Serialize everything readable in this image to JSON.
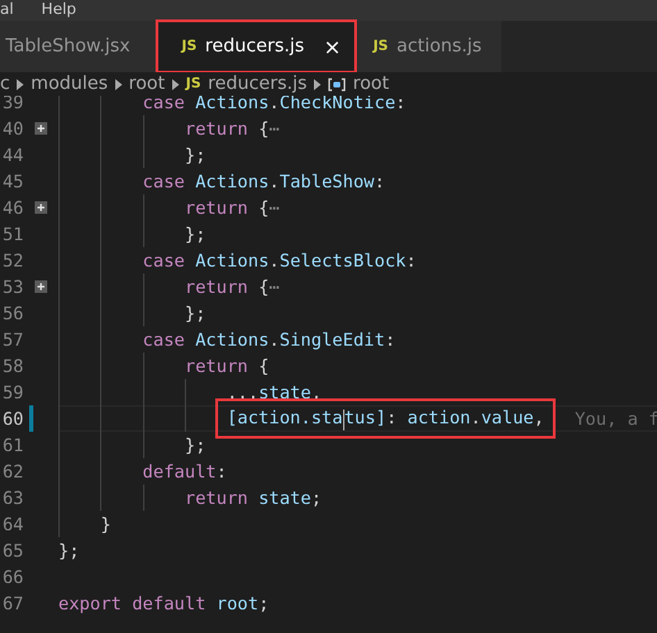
{
  "menu": [
    "al",
    "Help"
  ],
  "tabs": [
    {
      "label": "TableShow.jsx",
      "selected": false,
      "highlighted": false
    },
    {
      "badge": "JS",
      "label": "reducers.js",
      "selected": true,
      "highlighted": true,
      "close": "×"
    },
    {
      "badge": "JS",
      "label": "actions.js",
      "selected": false,
      "highlighted": false
    }
  ],
  "breadcrumb": [
    {
      "kind": "folder",
      "label": "c"
    },
    {
      "kind": "folder",
      "label": "modules"
    },
    {
      "kind": "folder",
      "label": "root"
    },
    {
      "kind": "file",
      "badge": "JS",
      "label": "reducers.js"
    },
    {
      "kind": "symbol",
      "label": "root"
    }
  ],
  "lines": [
    {
      "number": "39",
      "folded": false,
      "current": false,
      "modified": false,
      "highlighted": false,
      "tokens": [
        {
          "kind": "keyword",
          "text": "        case "
        },
        {
          "kind": "variable",
          "text": "Actions"
        },
        {
          "kind": "punct",
          "text": "."
        },
        {
          "kind": "variable",
          "text": "CheckNotice"
        },
        {
          "kind": "punct",
          "text": ":"
        }
      ]
    },
    {
      "number": "40",
      "folded": true,
      "current": false,
      "modified": false,
      "highlighted": false,
      "tokens": [
        {
          "kind": "keyword",
          "text": "            return "
        },
        {
          "kind": "punct",
          "text": "{"
        },
        {
          "kind": "fold",
          "text": "⋯"
        }
      ]
    },
    {
      "number": "44",
      "folded": false,
      "current": false,
      "modified": false,
      "highlighted": false,
      "tokens": [
        {
          "kind": "punct",
          "text": "            };"
        }
      ]
    },
    {
      "number": "45",
      "folded": false,
      "current": false,
      "modified": false,
      "highlighted": false,
      "tokens": [
        {
          "kind": "keyword",
          "text": "        case "
        },
        {
          "kind": "variable",
          "text": "Actions"
        },
        {
          "kind": "punct",
          "text": "."
        },
        {
          "kind": "variable",
          "text": "TableShow"
        },
        {
          "kind": "punct",
          "text": ":"
        }
      ]
    },
    {
      "number": "46",
      "folded": true,
      "current": false,
      "modified": false,
      "highlighted": false,
      "tokens": [
        {
          "kind": "keyword",
          "text": "            return "
        },
        {
          "kind": "punct",
          "text": "{"
        },
        {
          "kind": "fold",
          "text": "⋯"
        }
      ]
    },
    {
      "number": "51",
      "folded": false,
      "current": false,
      "modified": false,
      "highlighted": false,
      "tokens": [
        {
          "kind": "punct",
          "text": "            };"
        }
      ]
    },
    {
      "number": "52",
      "folded": false,
      "current": false,
      "modified": false,
      "highlighted": false,
      "tokens": [
        {
          "kind": "keyword",
          "text": "        case "
        },
        {
          "kind": "variable",
          "text": "Actions"
        },
        {
          "kind": "punct",
          "text": "."
        },
        {
          "kind": "variable",
          "text": "SelectsBlock"
        },
        {
          "kind": "punct",
          "text": ":"
        }
      ]
    },
    {
      "number": "53",
      "folded": true,
      "current": false,
      "modified": false,
      "highlighted": false,
      "tokens": [
        {
          "kind": "keyword",
          "text": "            return "
        },
        {
          "kind": "punct",
          "text": "{"
        },
        {
          "kind": "fold",
          "text": "⋯"
        }
      ]
    },
    {
      "number": "56",
      "folded": false,
      "current": false,
      "modified": false,
      "highlighted": false,
      "tokens": [
        {
          "kind": "punct",
          "text": "            };"
        }
      ]
    },
    {
      "number": "57",
      "folded": false,
      "current": false,
      "modified": false,
      "highlighted": false,
      "tokens": [
        {
          "kind": "keyword",
          "text": "        case "
        },
        {
          "kind": "variable",
          "text": "Actions"
        },
        {
          "kind": "punct",
          "text": "."
        },
        {
          "kind": "variable",
          "text": "SingleEdit"
        },
        {
          "kind": "punct",
          "text": ":"
        }
      ]
    },
    {
      "number": "58",
      "folded": false,
      "current": false,
      "modified": false,
      "highlighted": false,
      "tokens": [
        {
          "kind": "keyword",
          "text": "            return "
        },
        {
          "kind": "punct",
          "text": "{"
        }
      ]
    },
    {
      "number": "59",
      "folded": false,
      "current": false,
      "modified": false,
      "highlighted": false,
      "tokens": [
        {
          "kind": "punct",
          "text": "                ..."
        },
        {
          "kind": "variable",
          "text": "state"
        },
        {
          "kind": "punct",
          "text": ","
        }
      ]
    },
    {
      "number": "60",
      "folded": false,
      "current": true,
      "modified": true,
      "highlighted": true,
      "blame": "You, a f",
      "tokens": [
        {
          "kind": "variable",
          "text": "                [action.sta"
        },
        {
          "kind": "cursor"
        },
        {
          "kind": "variable",
          "text": "tus]"
        },
        {
          "kind": "punct",
          "text": ": "
        },
        {
          "kind": "variable",
          "text": "action"
        },
        {
          "kind": "punct",
          "text": "."
        },
        {
          "kind": "variable",
          "text": "value"
        },
        {
          "kind": "punct",
          "text": ","
        }
      ]
    },
    {
      "number": "61",
      "folded": false,
      "current": false,
      "modified": false,
      "highlighted": false,
      "tokens": [
        {
          "kind": "punct",
          "text": "            };"
        }
      ]
    },
    {
      "number": "62",
      "folded": false,
      "current": false,
      "modified": false,
      "highlighted": false,
      "tokens": [
        {
          "kind": "keyword",
          "text": "        default"
        },
        {
          "kind": "punct",
          "text": ":"
        }
      ]
    },
    {
      "number": "63",
      "folded": false,
      "current": false,
      "modified": false,
      "highlighted": false,
      "tokens": [
        {
          "kind": "keyword",
          "text": "            return "
        },
        {
          "kind": "variable",
          "text": "state"
        },
        {
          "kind": "punct",
          "text": ";"
        }
      ]
    },
    {
      "number": "64",
      "folded": false,
      "current": false,
      "modified": false,
      "highlighted": false,
      "tokens": [
        {
          "kind": "punct",
          "text": "    }"
        }
      ]
    },
    {
      "number": "65",
      "folded": false,
      "current": false,
      "modified": false,
      "highlighted": false,
      "tokens": [
        {
          "kind": "punct",
          "text": "};"
        }
      ]
    },
    {
      "number": "66",
      "folded": false,
      "current": false,
      "modified": false,
      "highlighted": false
    },
    {
      "number": "67",
      "folded": false,
      "current": false,
      "modified": false,
      "highlighted": false,
      "tokens": [
        {
          "kind": "keyword",
          "text": "export default "
        },
        {
          "kind": "variable",
          "text": "root"
        },
        {
          "kind": "punct",
          "text": ";"
        }
      ]
    }
  ]
}
